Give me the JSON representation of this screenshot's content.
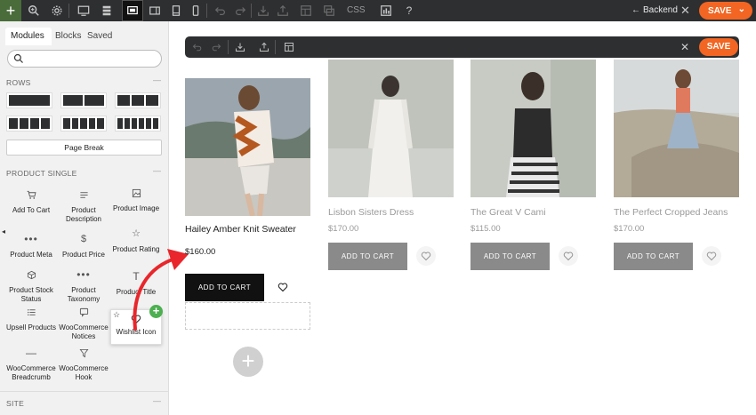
{
  "topbar": {
    "css_label": "CSS",
    "backend_label": "Backend",
    "save_label": "SAVE"
  },
  "panel": {
    "tabs": [
      "Modules",
      "Blocks",
      "Saved"
    ],
    "search_placeholder": "",
    "rows_title": "ROWS",
    "page_break": "Page Break",
    "product_single_title": "PRODUCT SINGLE",
    "site_title": "SITE",
    "modules": [
      {
        "label": "Add To Cart",
        "icon": "cart-icon"
      },
      {
        "label": "Product Description",
        "icon": "description-icon"
      },
      {
        "label": "Product Image",
        "icon": "image-icon"
      },
      {
        "label": "Product Meta",
        "icon": "dots-icon"
      },
      {
        "label": "Product Price",
        "icon": "dollar-icon"
      },
      {
        "label": "Product Rating",
        "icon": "star-icon"
      },
      {
        "label": "Product Stock Status",
        "icon": "box-icon"
      },
      {
        "label": "Product Taxonomy",
        "icon": "dots-icon"
      },
      {
        "label": "Product Title",
        "icon": "title-icon"
      },
      {
        "label": "Upsell Products",
        "icon": "list-icon"
      },
      {
        "label": "WooCommerce Notices",
        "icon": "notice-icon"
      },
      {
        "label": "WooCommerce Breadcrumb",
        "icon": "minus-icon"
      },
      {
        "label": "WooCommerce Hook",
        "icon": "funnel-icon"
      }
    ],
    "drag_card": {
      "label": "Wishlist Icon",
      "icon": "heart-icon"
    }
  },
  "editor": {
    "save_label": "SAVE"
  },
  "products": [
    {
      "name": "Hailey Amber Knit Sweater",
      "price": "$160.00",
      "cart_label": "ADD TO CART"
    },
    {
      "name": "Lisbon Sisters Dress",
      "price": "$170.00",
      "cart_label": "ADD TO CART"
    },
    {
      "name": "The Great V Cami",
      "price": "$115.00",
      "cart_label": "ADD TO CART"
    },
    {
      "name": "The Perfect Cropped Jeans",
      "price": "$170.00",
      "cart_label": "ADD TO CART"
    }
  ],
  "colors": {
    "accent": "#f26522",
    "toolbar": "#2d2f31",
    "plus_green": "#4caf50",
    "arrow_red": "#e8262b"
  }
}
